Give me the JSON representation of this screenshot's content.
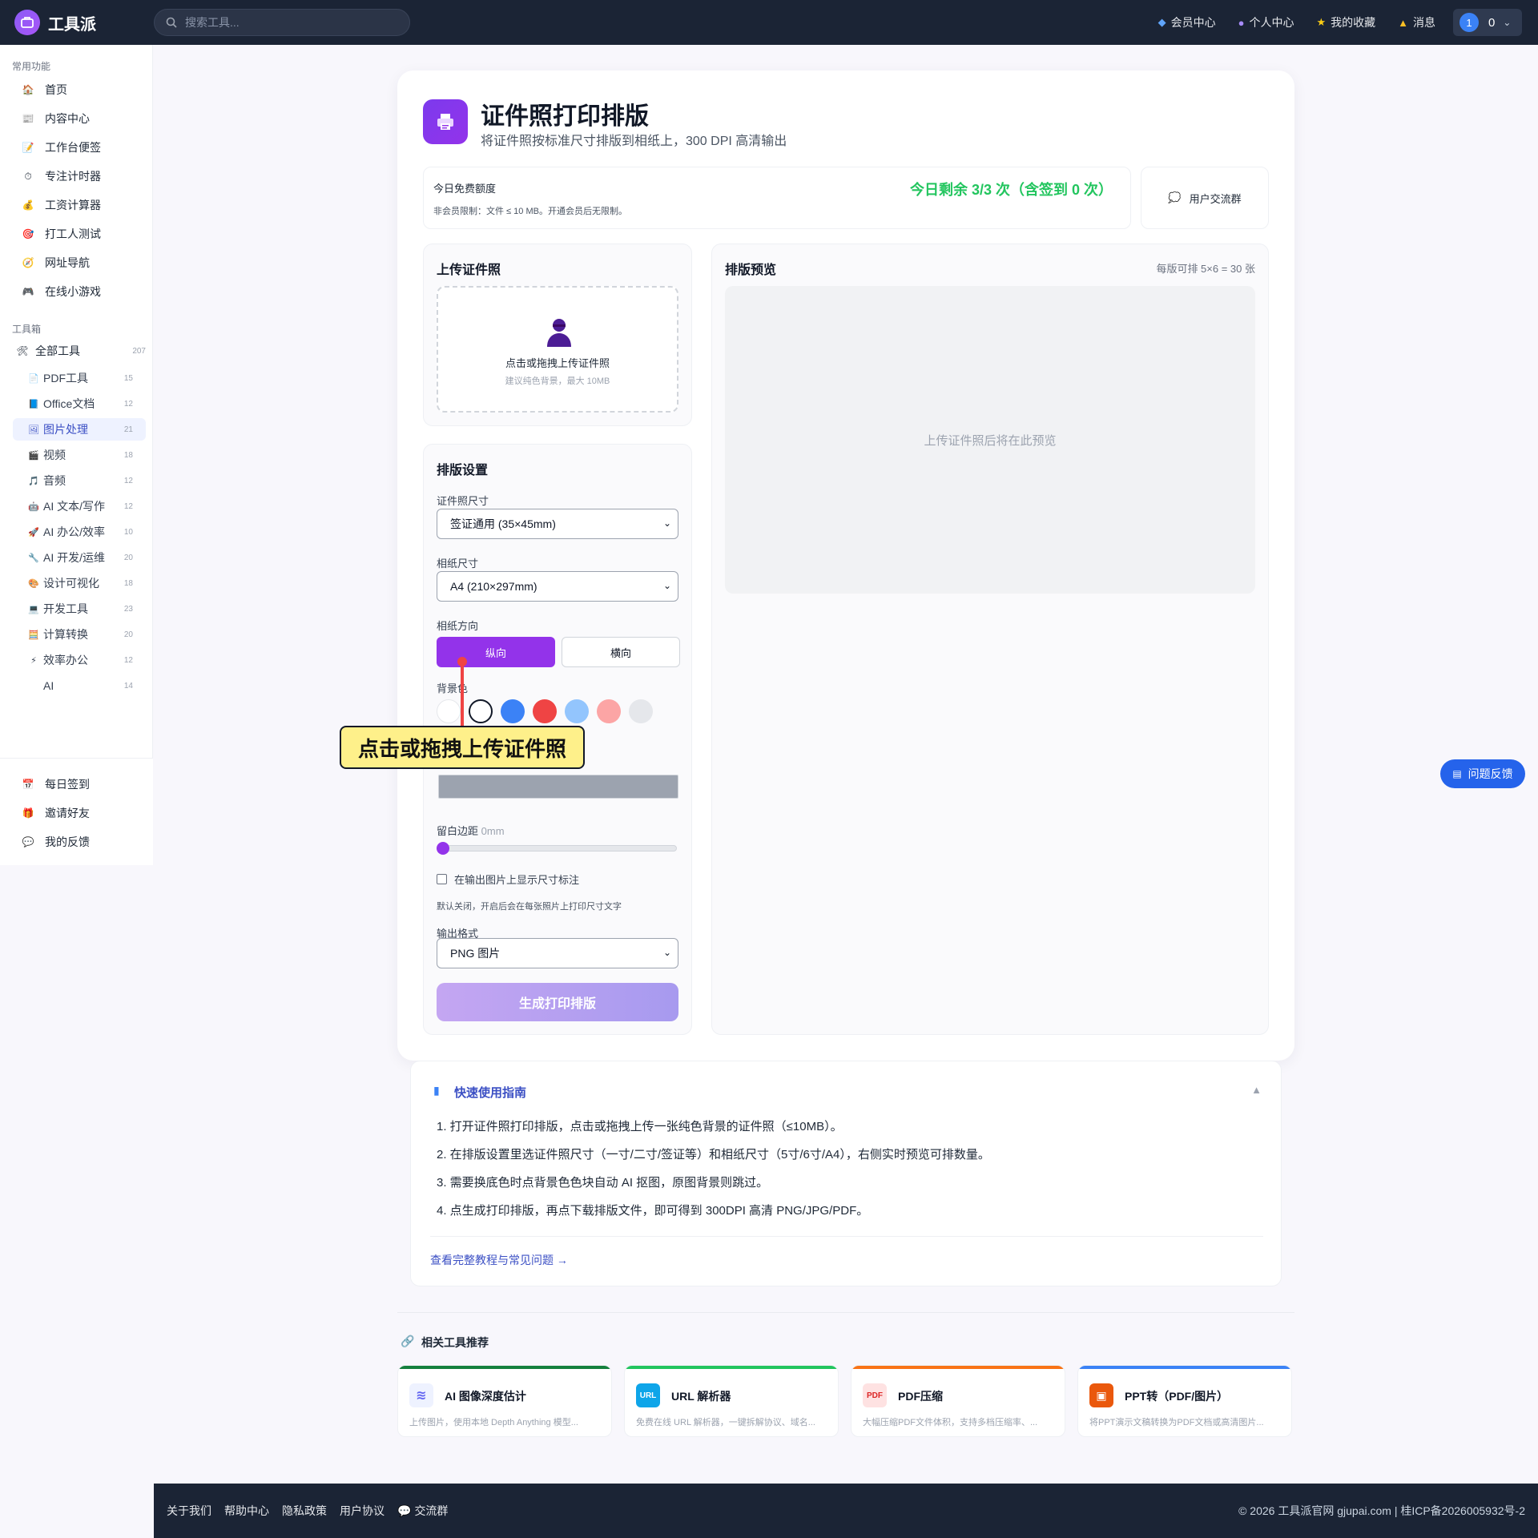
{
  "header": {
    "logo_text": "工具派",
    "search_placeholder": "搜索工具...",
    "nav": [
      {
        "label": "会员中心",
        "icon": "diamond-icon"
      },
      {
        "label": "个人中心",
        "icon": "user-icon"
      },
      {
        "label": "我的收藏",
        "icon": "star-icon"
      },
      {
        "label": "消息",
        "icon": "bell-icon"
      }
    ],
    "avatar_text": "1",
    "user_count": "0"
  },
  "sidebar": {
    "common_title": "常用功能",
    "common": [
      {
        "label": "首页",
        "icon": "🏠"
      },
      {
        "label": "内容中心",
        "icon": "📰"
      },
      {
        "label": "工作台便签",
        "icon": "📝"
      },
      {
        "label": "专注计时器",
        "icon": "⏱"
      },
      {
        "label": "工资计算器",
        "icon": "💰"
      },
      {
        "label": "打工人测试",
        "icon": "🎯"
      },
      {
        "label": "网址导航",
        "icon": "🧭"
      },
      {
        "label": "在线小游戏",
        "icon": "🎮"
      }
    ],
    "toolbox_title": "工具箱",
    "all_tools": {
      "label": "全部工具",
      "count": "207",
      "icon": "🛠"
    },
    "tools": [
      {
        "label": "PDF工具",
        "count": "15",
        "icon": "📄"
      },
      {
        "label": "Office文档",
        "count": "12",
        "icon": "📘"
      },
      {
        "label": "图片处理",
        "count": "21",
        "icon": "🖼"
      },
      {
        "label": "视频",
        "count": "18",
        "icon": "🎬"
      },
      {
        "label": "音频",
        "count": "12",
        "icon": "🎵"
      },
      {
        "label": "AI 文本/写作",
        "count": "12",
        "icon": "🤖"
      },
      {
        "label": "AI 办公/效率",
        "count": "10",
        "icon": "🚀"
      },
      {
        "label": "AI 开发/运维",
        "count": "20",
        "icon": "🔧"
      },
      {
        "label": "设计可视化",
        "count": "18",
        "icon": "🎨"
      },
      {
        "label": "开发工具",
        "count": "23",
        "icon": "💻"
      },
      {
        "label": "计算转换",
        "count": "20",
        "icon": "🧮"
      },
      {
        "label": "效率办公",
        "count": "12",
        "icon": "⚡"
      },
      {
        "label": "AI",
        "count": "14",
        "icon": ""
      }
    ],
    "bottom": [
      {
        "label": "每日签到",
        "icon": "📅"
      },
      {
        "label": "邀请好友",
        "icon": "🎁"
      },
      {
        "label": "我的反馈",
        "icon": "💬"
      }
    ]
  },
  "main": {
    "title": "证件照打印排版",
    "subtitle": "将证件照按标准尺寸排版到相纸上，300 DPI 高清输出",
    "quota_label": "今日免费额度",
    "quota_note": "非会员限制：文件 ≤ 10 MB。开通会员后无限制。",
    "quota_remain": "今日剩余 3/3 次（含签到 0 次）",
    "group_label": "用户交流群",
    "upload_title": "上传证件照",
    "upload_main": "点击或拖拽上传证件照",
    "upload_hint": "建议纯色背景，最大 10MB",
    "settings_title": "排版设置",
    "photo_size_label": "证件照尺寸",
    "photo_size_value": "签证通用 (35×45mm)",
    "paper_size_label": "相纸尺寸",
    "paper_size_value": "A4 (210×297mm)",
    "orientation_label": "相纸方向",
    "orientation_portrait": "纵向",
    "orientation_landscape": "横向",
    "bg_label": "背景色",
    "bg_colors": [
      "#ffffff",
      "#ffffff",
      "#3b82f6",
      "#ef4444",
      "#93c5fd",
      "#fca5a5",
      "#e5e7eb"
    ],
    "margin_label": "留白边距",
    "margin_value": "0mm",
    "show_size_label": "在输出图片上显示尺寸标注",
    "show_size_hint": "默认关闭，开启后会在每张照片上打印尺寸文字",
    "format_label": "输出格式",
    "format_value": "PNG 图片",
    "generate_label": "生成打印排版",
    "preview_title": "排版预览",
    "preview_count": "每版可排 5×6 = 30 张",
    "preview_placeholder": "上传证件照后将在此预览"
  },
  "callout": {
    "text": "点击或拖拽上传证件照"
  },
  "guide": {
    "title": "快速使用指南",
    "steps": [
      "1. 打开证件照打印排版，点击或拖拽上传一张纯色背景的证件照（≤10MB）。",
      "2. 在排版设置里选证件照尺寸（一寸/二寸/签证等）和相纸尺寸（5寸/6寸/A4），右侧实时预览可排数量。",
      "3. 需要换底色时点背景色色块自动 AI 抠图，原图背景则跳过。",
      "4. 点生成打印排版，再点下载排版文件，即可得到 300DPI 高清 PNG/JPG/PDF。"
    ],
    "link": "查看完整教程与常见问题 →"
  },
  "related": {
    "title": "相关工具推荐",
    "items": [
      {
        "name": "AI 图像深度估计",
        "desc": "上传图片，使用本地 Depth Anything 模型...",
        "color": "#15803d",
        "icon_text": "≋",
        "icon_bg": "#eef2ff",
        "icon_fg": "#6366f1"
      },
      {
        "name": "URL 解析器",
        "desc": "免费在线 URL 解析器，一键拆解协议、域名...",
        "color": "#22c55e",
        "icon_text": "URL",
        "icon_bg": "#0ea5e9",
        "icon_fg": "#ffffff"
      },
      {
        "name": "PDF压缩",
        "desc": "大幅压缩PDF文件体积，支持多档压缩率、...",
        "color": "#f97316",
        "icon_text": "PDF",
        "icon_bg": "#fee2e2",
        "icon_fg": "#dc2626"
      },
      {
        "name": "PPT转（PDF/图片）",
        "desc": "将PPT演示文稿转换为PDF文档或高清图片...",
        "color": "#3b82f6",
        "icon_text": "▣",
        "icon_bg": "#ea580c",
        "icon_fg": "#ffffff"
      }
    ]
  },
  "feedback_label": "问题反馈",
  "footer": {
    "links": [
      "关于我们",
      "帮助中心",
      "隐私政策",
      "用户协议",
      "交流群"
    ],
    "copyright": "© 2026 工具派官网 gjupai.com | 桂ICP备2026005932号-2"
  }
}
